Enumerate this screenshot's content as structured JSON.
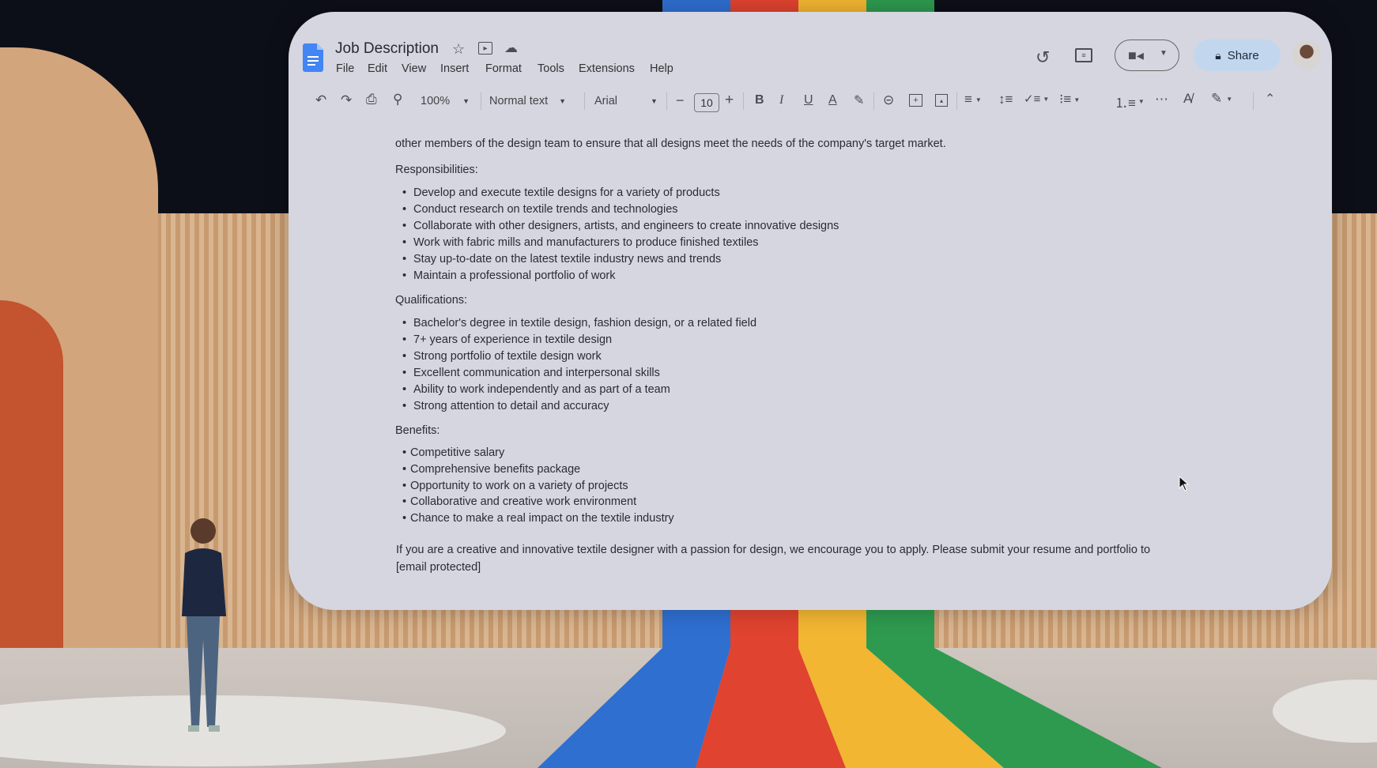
{
  "doc": {
    "title": "Job Description"
  },
  "menu": [
    "File",
    "Edit",
    "View",
    "Insert",
    "Format",
    "Tools",
    "Extensions",
    "Help"
  ],
  "toolbar": {
    "zoom": "100%",
    "style": "Normal text",
    "font": "Arial",
    "font_size": "10"
  },
  "header": {
    "share_label": "Share"
  },
  "content": {
    "intro_tail": "other members of the design team to ensure that all designs meet the needs of the company's target market.",
    "responsibilities_heading": "Responsibilities:",
    "responsibilities": [
      "Develop and execute textile designs for a variety of products",
      "Conduct research on textile trends and technologies",
      "Collaborate with other designers, artists, and engineers to create innovative designs",
      "Work with fabric mills and manufacturers to produce finished textiles",
      "Stay up-to-date on the latest textile industry news and trends",
      "Maintain a professional portfolio of work"
    ],
    "qualifications_heading": "Qualifications:",
    "qualifications": [
      "Bachelor's degree in textile design, fashion design, or a related field",
      "7+ years of experience in textile design",
      "Strong portfolio of textile design work",
      "Excellent communication and interpersonal skills",
      "Ability to work independently and as part of a team",
      "Strong attention to detail and accuracy"
    ],
    "benefits_heading": "Benefits:",
    "benefits": [
      "Competitive salary",
      "Comprehensive benefits package",
      "Opportunity to work on a variety of projects",
      "Collaborative and creative work environment",
      "Chance to make a real impact on the textile industry"
    ],
    "closing_line1": "If you are a creative and innovative textile designer with a passion for design, we encourage you to apply. Please submit your resume and portfolio to",
    "closing_line2": "[email protected]"
  },
  "colors": {
    "docs_blue": "#4285f4",
    "share_bg": "#c2d7ee",
    "stage_blue": "#2f6fd0",
    "stage_red": "#e0432f",
    "stage_yellow": "#f2b632",
    "stage_green": "#2e9a4f"
  }
}
